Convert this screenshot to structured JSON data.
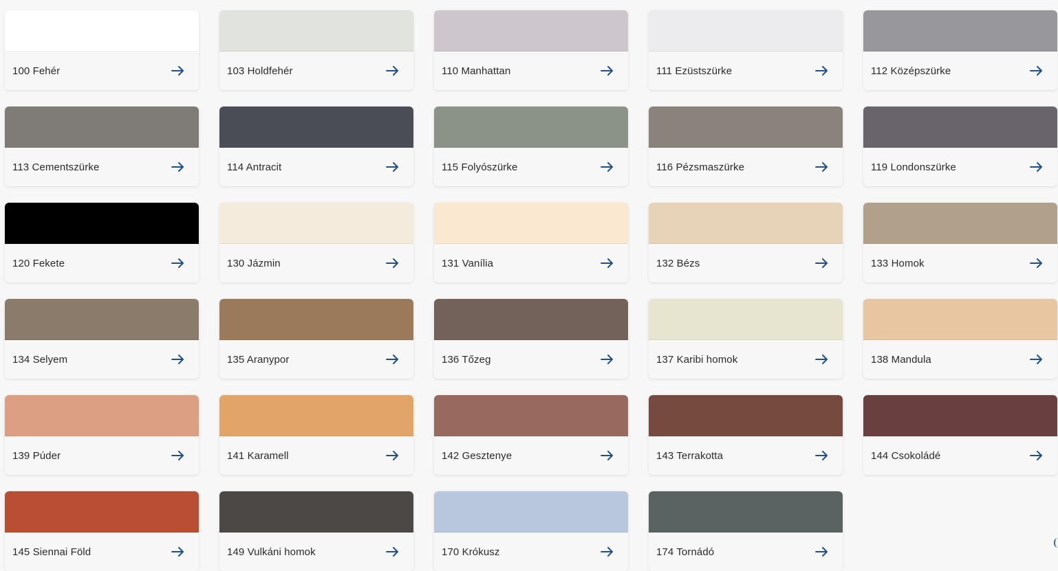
{
  "colors": [
    {
      "label": "100 Fehér",
      "hex": "#ffffff"
    },
    {
      "label": "103 Holdfehér",
      "hex": "#e1e4de"
    },
    {
      "label": "110 Manhattan",
      "hex": "#cdc7cd"
    },
    {
      "label": "111 Ezüstszürke",
      "hex": "#ececee"
    },
    {
      "label": "112 Középszürke",
      "hex": "#98979c"
    },
    {
      "label": "113 Cementszürke",
      "hex": "#7f7c77"
    },
    {
      "label": "114 Antracit",
      "hex": "#4a4d55"
    },
    {
      "label": "115 Folyószürke",
      "hex": "#8b9288"
    },
    {
      "label": "116 Pézsmaszürke",
      "hex": "#8a837b"
    },
    {
      "label": "119 Londonszürke",
      "hex": "#69646b"
    },
    {
      "label": "120 Fekete",
      "hex": "#000000"
    },
    {
      "label": "130 Jázmin",
      "hex": "#f5ebdc"
    },
    {
      "label": "131 Vanília",
      "hex": "#fbe8d0"
    },
    {
      "label": "132 Bézs",
      "hex": "#e7d4b8"
    },
    {
      "label": "133 Homok",
      "hex": "#b2a18a"
    },
    {
      "label": "134 Selyem",
      "hex": "#8b7b6a"
    },
    {
      "label": "135 Aranypor",
      "hex": "#9b7a5b"
    },
    {
      "label": "136 Tőzeg",
      "hex": "#72625a"
    },
    {
      "label": "137 Karibi homok",
      "hex": "#e7e4d0"
    },
    {
      "label": "138 Mandula",
      "hex": "#e8c6a1"
    },
    {
      "label": "139 Púder",
      "hex": "#dd9f84"
    },
    {
      "label": "141 Karamell",
      "hex": "#e2a467"
    },
    {
      "label": "142 Gesztenye",
      "hex": "#98695d"
    },
    {
      "label": "143 Terrakotta",
      "hex": "#764a3f"
    },
    {
      "label": "144 Csokoládé",
      "hex": "#693f3f"
    },
    {
      "label": "145 Siennai Föld",
      "hex": "#b94e33"
    },
    {
      "label": "149 Vulkáni homok",
      "hex": "#4c4845"
    },
    {
      "label": "170 Krókusz",
      "hex": "#b8c7de"
    },
    {
      "label": "174 Tornádó",
      "hex": "#5a6361"
    }
  ],
  "arrow_icon": "arrow-right-icon",
  "arrow_color": "#1f4e8c"
}
